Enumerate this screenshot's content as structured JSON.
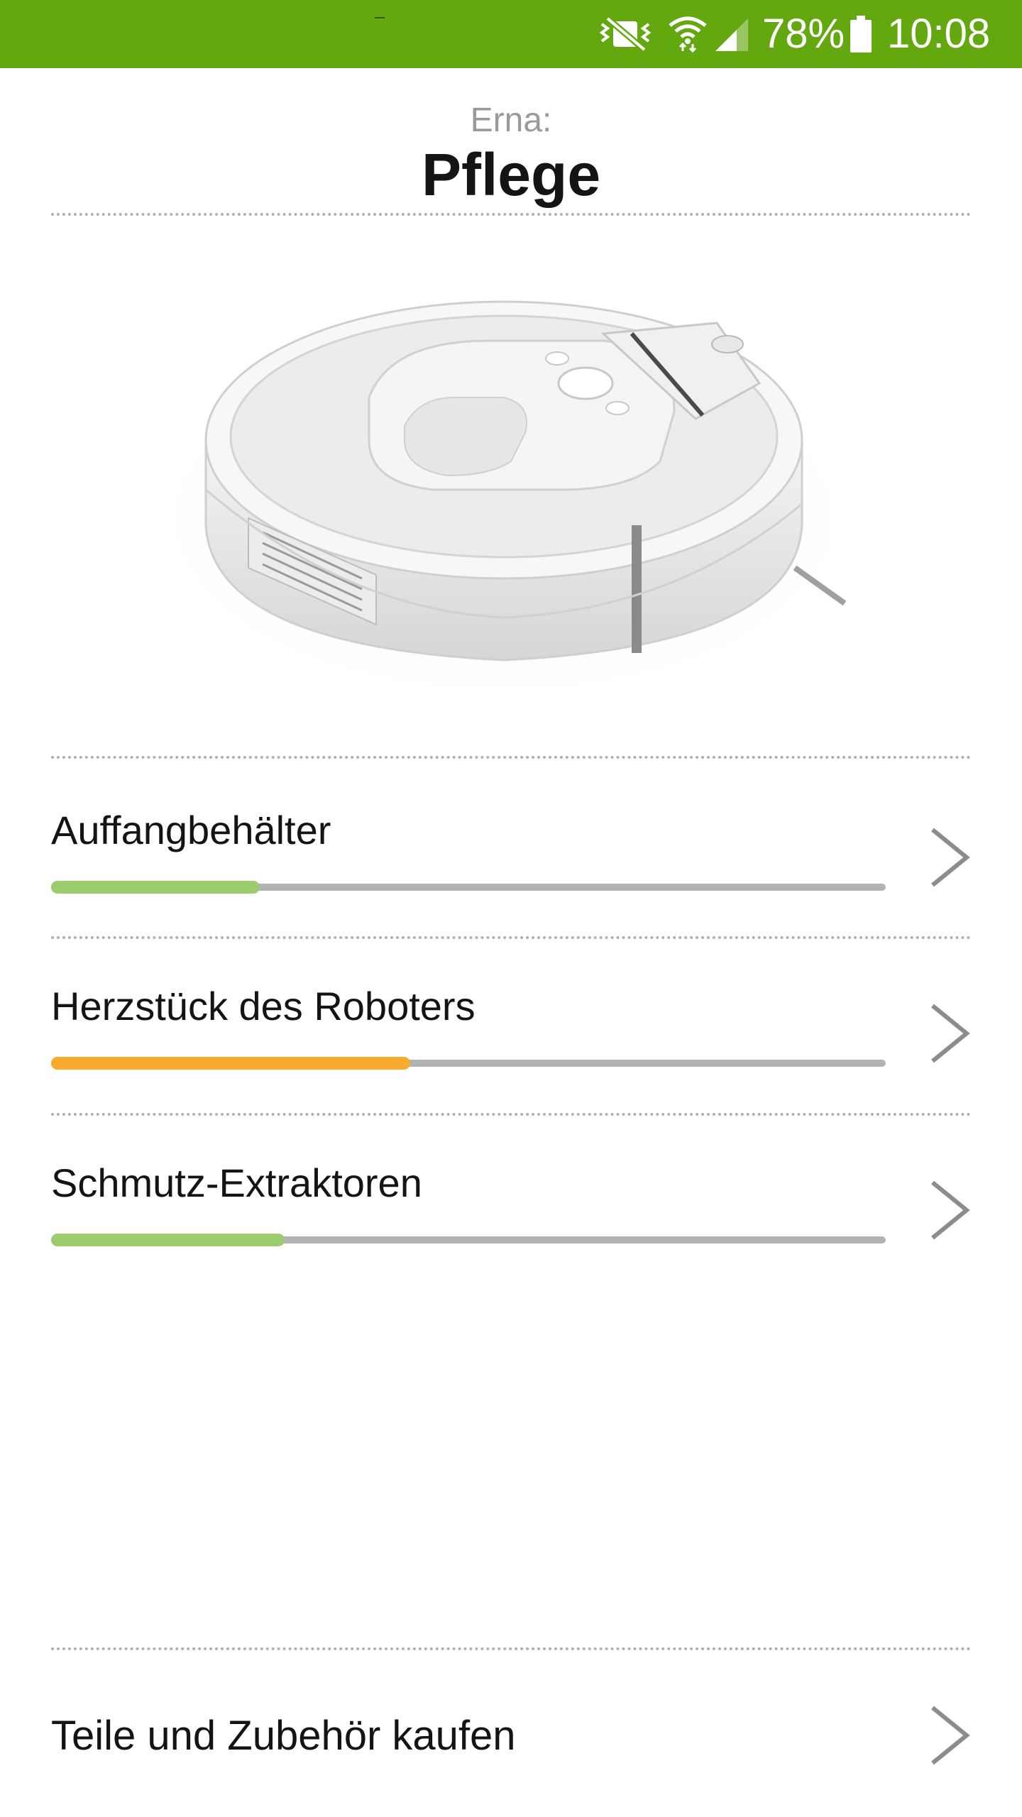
{
  "status_bar": {
    "battery_percent": "78%",
    "time": "10:08",
    "background_color": "#63a80f",
    "icons": [
      "mute-vibrate-icon",
      "wifi-icon",
      "cell-signal-icon",
      "battery-icon"
    ]
  },
  "header": {
    "robot_name": "Erna:",
    "title": "Pflege"
  },
  "maintenance_items": [
    {
      "label": "Auffangbehälter",
      "remaining": 0.25,
      "color": "#9ccc6e"
    },
    {
      "label": "Herzstück des Roboters",
      "remaining": 0.43,
      "color": "#f9ab2b"
    },
    {
      "label": "Schmutz-Extraktoren",
      "remaining": 0.28,
      "color": "#9ccc6e"
    }
  ],
  "shop": {
    "label": "Teile und Zubehör kaufen"
  }
}
